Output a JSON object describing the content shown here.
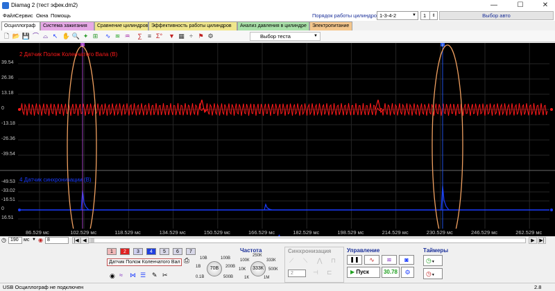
{
  "window": {
    "title": "Diamag 2 (тест эфек.dm2)",
    "buttons": [
      "—",
      "☐",
      "✕"
    ]
  },
  "menu": {
    "items": [
      "Файл",
      "Сервис",
      "Окна",
      "Помощь"
    ],
    "cylinder_order_label": "Порядок работы цилиндров",
    "cylinder_order_value": "1-3-4-2",
    "cylinder_spin_value": "1",
    "auto_select_label": "Выбор авто"
  },
  "tabs": [
    {
      "label": "Осциллограф",
      "color": "#ffffff"
    },
    {
      "label": "Система зажигания",
      "color": "#e6a8e6"
    },
    {
      "label": "Сравнение цилиндров",
      "color": "#f0e68c"
    },
    {
      "label": "Эффективность работы цилиндров",
      "color": "#f0e68c"
    },
    {
      "label": "Анализ давления в цилиндре",
      "color": "#a8e0a8"
    },
    {
      "label": "Электропитание",
      "color": "#f4c68c"
    }
  ],
  "toolbar": {
    "test_select_label": "Выбор теста"
  },
  "oscillograph": {
    "channel2_title": "2 Датчик Полож Коленчатого Вала (В)",
    "channel4_title": "4 Датчик синхронизации (В)",
    "channel2_yticks": [
      "39.54",
      "26.36",
      "13.18",
      "0",
      "-13.18",
      "-26.36",
      "-39.54"
    ],
    "channel4_yticks": [
      "-49.53",
      "-33.02",
      "-16.51",
      "0",
      "16.51"
    ],
    "xticks": [
      "86.529 мс",
      "102.529 мс",
      "118.529 мс",
      "134.529 мс",
      "150.529 мс",
      "166.529 мс",
      "182.529 мс",
      "198.529 мс",
      "214.529 мс",
      "230.529 мс",
      "246.529 мс",
      "262.529 мс"
    ],
    "cursor1_label": "1",
    "cursor2_label": "2",
    "colors": {
      "channel2": "#ff1a1a",
      "channel4": "#1a3cff",
      "annotation": "#f0a060"
    }
  },
  "scrollbar": {
    "time_value": "190",
    "time_unit": "мс",
    "channel_value": "8"
  },
  "channels": {
    "buttons": [
      "1",
      "2",
      "3",
      "4",
      "5",
      "6",
      "7"
    ],
    "sensor_label": "Датчик Полож Коленчатого Вал"
  },
  "range": {
    "labels": [
      "10В",
      "100В",
      "1В",
      "200В",
      "0.1В",
      "500В"
    ],
    "current": "70В"
  },
  "frequency": {
    "title": "Частота",
    "labels": [
      "250К",
      "100К",
      "333К",
      "10К",
      "500К",
      "1К",
      "1М"
    ],
    "current": "333К"
  },
  "sync": {
    "title": "Синхронизация",
    "channel_value": "2"
  },
  "control": {
    "title": "Управление",
    "start_label": "Пуск",
    "value_label": "30.78"
  },
  "timers": {
    "title": "Таймеры"
  },
  "status": {
    "text": "USB Осциллограф не подключен",
    "version": "2.8"
  }
}
